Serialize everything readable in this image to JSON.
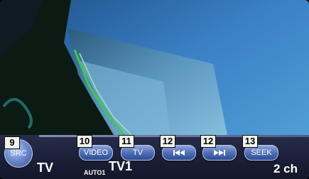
{
  "source_button": {
    "label": "SRC",
    "callout": "9"
  },
  "buttons": [
    {
      "label": "VIDEO",
      "callout": "10"
    },
    {
      "label": "TV",
      "callout": "11"
    },
    {
      "label": "",
      "icon": "previous-icon",
      "callout": "12"
    },
    {
      "label": "",
      "icon": "next-icon",
      "callout": "12"
    },
    {
      "label": "SEEK",
      "callout": "13"
    }
  ],
  "status": {
    "source": "TV",
    "band": "TV1",
    "mode": "AUTO1",
    "channel": "2 ch"
  },
  "colors": {
    "button_gradient_top": "#8fa7dd",
    "button_gradient_bottom": "#2e4c92",
    "bar_background": "#1a1e36",
    "video_sky": "#3a7fc2"
  }
}
